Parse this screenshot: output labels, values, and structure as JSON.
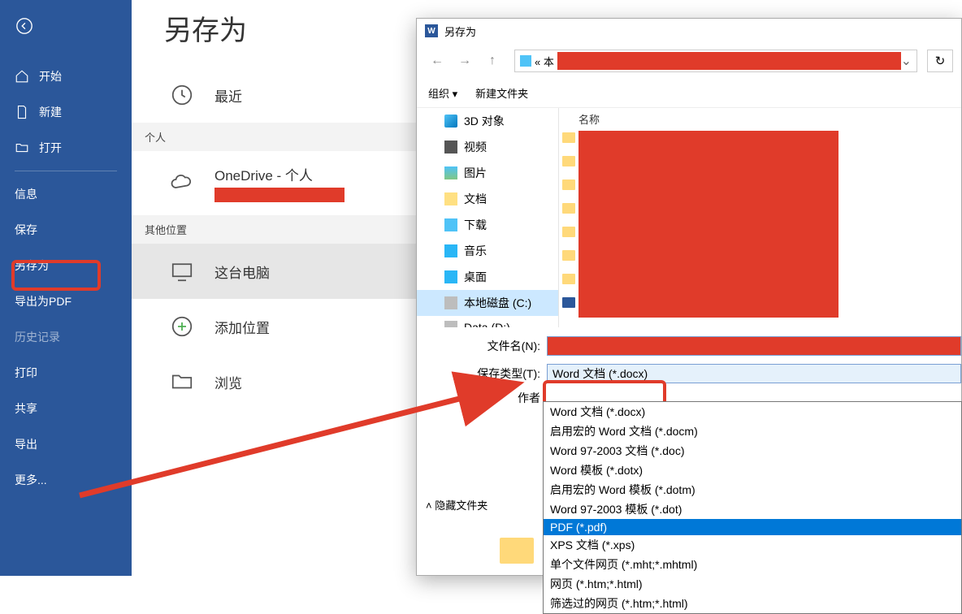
{
  "sidebar": {
    "items": [
      {
        "label": "开始"
      },
      {
        "label": "新建"
      },
      {
        "label": "打开"
      },
      {
        "label": "信息"
      },
      {
        "label": "保存"
      },
      {
        "label": "另存为"
      },
      {
        "label": "导出为PDF"
      },
      {
        "label": "历史记录"
      },
      {
        "label": "打印"
      },
      {
        "label": "共享"
      },
      {
        "label": "导出"
      },
      {
        "label": "更多..."
      }
    ]
  },
  "mid": {
    "title": "另存为",
    "recent": "最近",
    "section_personal": "个人",
    "onedrive": "OneDrive - 个人",
    "section_other": "其他位置",
    "thispc": "这台电脑",
    "addplace": "添加位置",
    "browse": "浏览"
  },
  "dialog": {
    "title": "另存为",
    "addr_prefix": "« 本",
    "toolbar_org": "组织 ▾",
    "toolbar_new": "新建文件夹",
    "tree": [
      "3D 对象",
      "视频",
      "图片",
      "文档",
      "下载",
      "音乐",
      "桌面",
      "本地磁盘 (C:)",
      "Data (D:)"
    ],
    "col_name": "名称",
    "label_filename": "文件名(N):",
    "label_filetype": "保存类型(T):",
    "label_author": "作者",
    "filetype_value": "Word 文档 (*.docx)",
    "hide_folders": "隐藏文件夹",
    "dropdown": [
      "Word 文档 (*.docx)",
      "启用宏的 Word 文档 (*.docm)",
      "Word 97-2003 文档 (*.doc)",
      "Word 模板 (*.dotx)",
      "启用宏的 Word 模板 (*.dotm)",
      "Word 97-2003 模板 (*.dot)",
      "PDF (*.pdf)",
      "XPS 文档 (*.xps)",
      "单个文件网页 (*.mht;*.mhtml)",
      "网页 (*.htm;*.html)",
      "筛选过的网页 (*.htm;*.html)"
    ],
    "dropdown_selected_index": 6
  }
}
